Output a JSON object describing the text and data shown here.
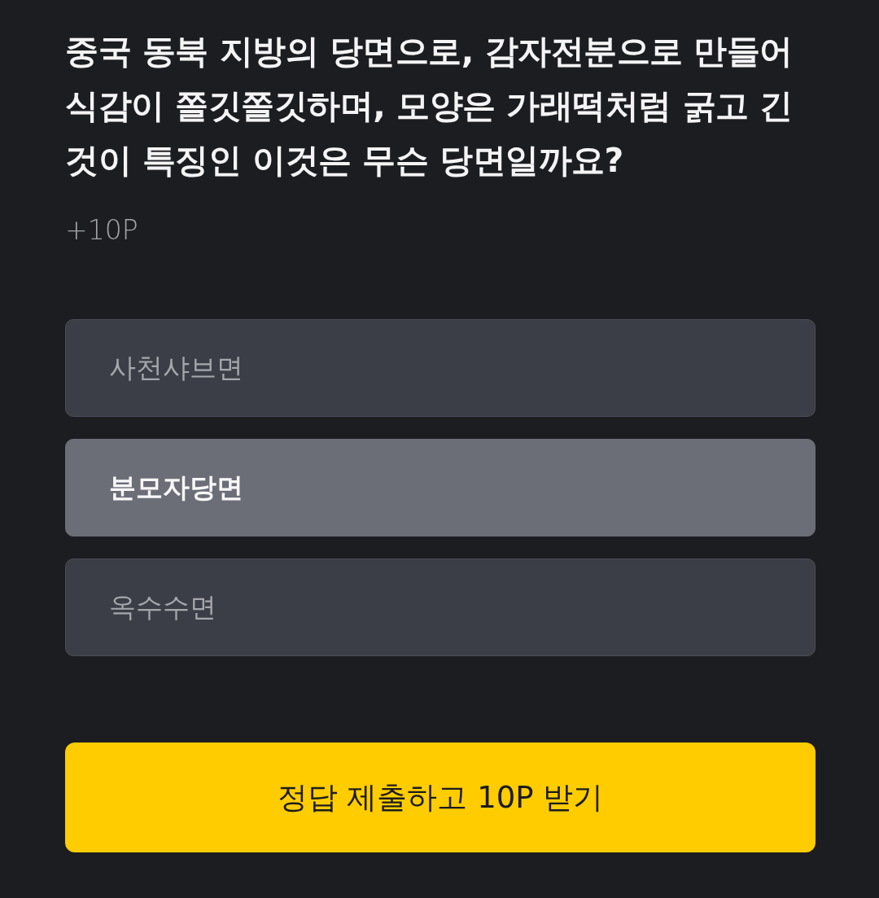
{
  "question": {
    "text": "중국 동북 지방의 당면으로, 감자전분으로 만들어 식감이 쫄깃쫄깃하며, 모양은 가래떡처럼 굵고 긴 것이 특징인 이것은 무슨 당면일까요?",
    "points": "+10P"
  },
  "options": [
    {
      "label": "사천샤브면",
      "selected": false
    },
    {
      "label": "분모자당면",
      "selected": true
    },
    {
      "label": "옥수수면",
      "selected": false
    }
  ],
  "submit_button": {
    "label": "정답 제출하고 10P 받기"
  }
}
